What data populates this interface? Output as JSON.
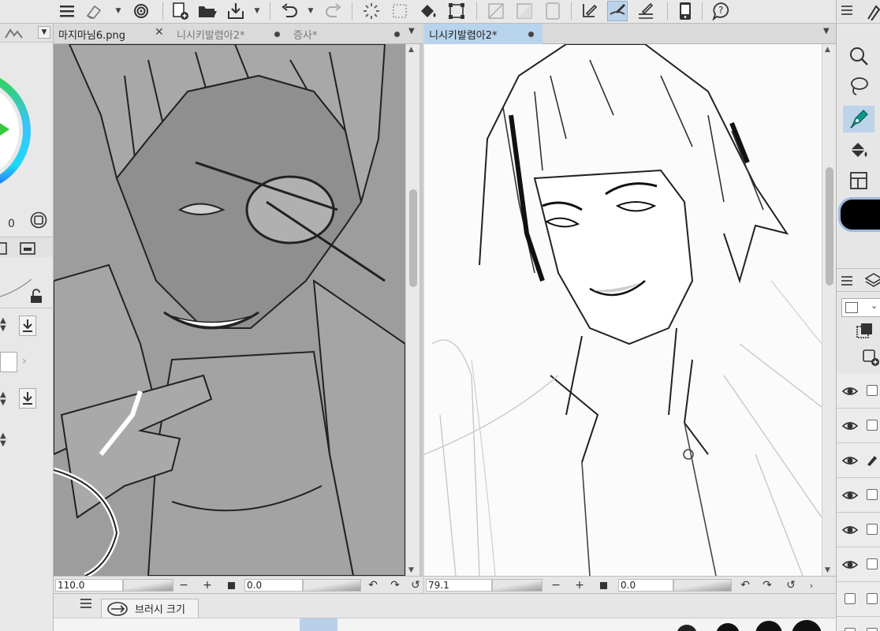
{
  "toolbar": {
    "buttons": [
      "menu-icon",
      "eraser-icon",
      "spiral-icon",
      "new-file-icon",
      "open-folder-icon",
      "save-icon",
      "undo-icon",
      "redo-icon",
      "loading-icon",
      "select-dotted-icon",
      "fill-bucket-icon",
      "transform-icon",
      "ruler-icon",
      "ruler-gradient-icon",
      "ruler-frame-icon",
      "pen-icon",
      "brush-icon",
      "pencil-ruler-icon",
      "phone-icon",
      "help-icon"
    ]
  },
  "left_panel": {
    "color_value": "0",
    "color_ring_accent": "#19d3f2"
  },
  "documents": [
    {
      "tabs": [
        {
          "label": "마지마님6.png",
          "state": "active",
          "close": "✕"
        },
        {
          "label": "니시키발렴아2*",
          "state": "inactive"
        },
        {
          "label": "증사*",
          "state": "inactive"
        }
      ],
      "status": {
        "zoom": "110.0",
        "rotation": "0.0"
      }
    },
    {
      "tabs": [
        {
          "label": "니시키발렴아2*",
          "state": "selected"
        }
      ],
      "status": {
        "zoom": "79.1",
        "rotation": "0.0"
      }
    }
  ],
  "bottom_panel": {
    "tab_label": "브러시 크기"
  },
  "right_panel": {
    "tools": [
      "zoom-icon",
      "lasso-icon",
      "pen-tool-icon",
      "fill-icon",
      "frame-icon"
    ],
    "current_color": "#000000",
    "layer_rows": 7
  }
}
